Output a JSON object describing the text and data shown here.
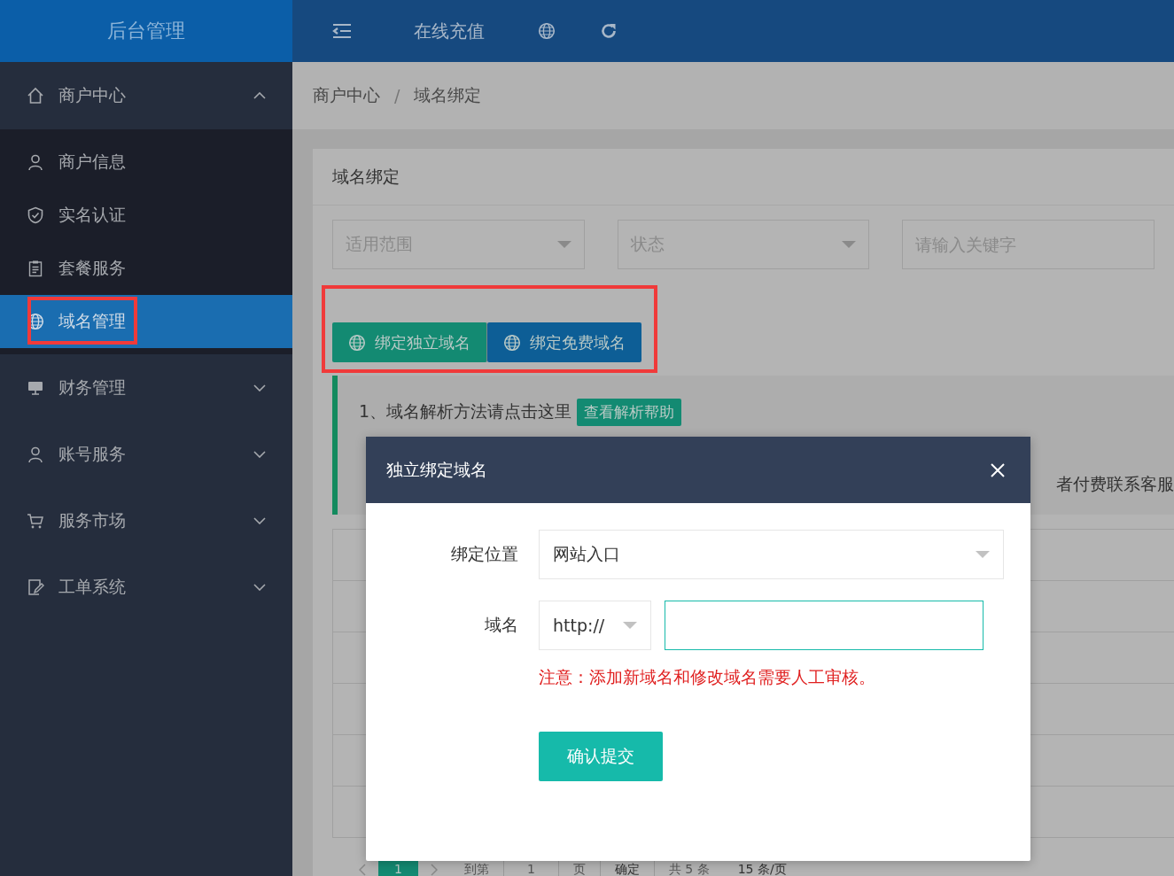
{
  "sidebar": {
    "title": "后台管理",
    "groups": [
      {
        "label": "商户中心",
        "expanded": true,
        "items": [
          {
            "label": "商户信息",
            "selected": false
          },
          {
            "label": "实名认证",
            "selected": false
          },
          {
            "label": "套餐服务",
            "selected": false
          },
          {
            "label": "域名管理",
            "selected": true
          }
        ]
      },
      {
        "label": "财务管理",
        "expanded": false
      },
      {
        "label": "账号服务",
        "expanded": false
      },
      {
        "label": "服务市场",
        "expanded": false
      },
      {
        "label": "工单系统",
        "expanded": false
      }
    ]
  },
  "topbar": {
    "items": [
      {
        "kind": "menu"
      },
      {
        "kind": "text",
        "label": "在线充值"
      },
      {
        "kind": "globe"
      },
      {
        "kind": "refresh"
      }
    ]
  },
  "breadcrumb": {
    "items": [
      "商户中心",
      "域名绑定"
    ],
    "separator": "/"
  },
  "panel": {
    "title": "域名绑定",
    "filters": [
      {
        "kind": "select",
        "placeholder": "适用范围"
      },
      {
        "kind": "select",
        "placeholder": "状态"
      },
      {
        "kind": "input",
        "placeholder": "请输入关键字"
      }
    ],
    "buttons": [
      {
        "label": "绑定独立域名",
        "color": "#138a72"
      },
      {
        "label": "绑定免费域名",
        "color": "#0d5e96"
      }
    ],
    "notes": [
      {
        "text": "1、域名解析方法请点击这里",
        "tag": "查看解析帮助"
      },
      {
        "tail": "者付费联系客服"
      }
    ],
    "pagination": {
      "current": "1",
      "goto_label": "到第",
      "goto_value": "1",
      "page_unit": "页",
      "confirm": "确定",
      "total": "共 5 条",
      "page_size": "15 条/页"
    }
  },
  "dialog": {
    "title": "独立绑定域名",
    "fields": [
      {
        "kind": "select",
        "label": "绑定位置",
        "value": "网站入口"
      },
      {
        "kind": "url",
        "label": "域名",
        "scheme": "http://"
      }
    ],
    "notice": "注意：添加新域名和修改域名需要人工审核。",
    "submit": "确认提交"
  }
}
